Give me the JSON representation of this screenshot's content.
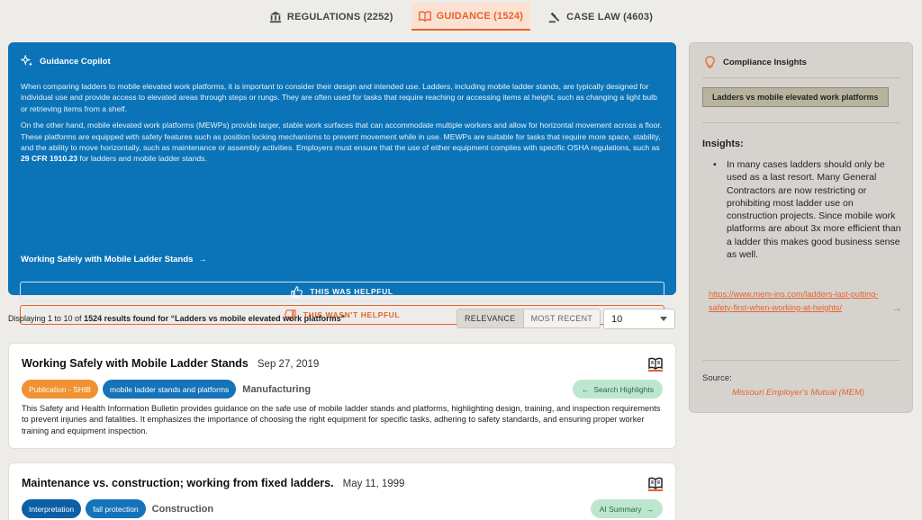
{
  "tabs": [
    {
      "label": "REGULATIONS (2252)",
      "icon": "bank-icon",
      "active": false
    },
    {
      "label": "GUIDANCE (1524)",
      "icon": "book-icon",
      "active": true
    },
    {
      "label": "CASE LAW (4603)",
      "icon": "gavel-icon",
      "active": false
    }
  ],
  "copilot": {
    "title": "Guidance Copilot",
    "para1": "When comparing ladders to mobile elevated work platforms, it is important to consider their design and intended use. Ladders, including mobile ladder stands, are typically designed for individual use and provide access to elevated areas through steps or rungs. They are often used for tasks that require reaching or accessing items at height, such as changing a light bulb or retrieving items from a shelf.",
    "para2_start": "On the other hand, mobile elevated work platforms (MEWPs) provide larger, stable work surfaces that can accommodate multiple workers and allow for horizontal movement across a floor. These platforms are equipped with safety features such as position locking mechanisms to prevent movement while in use. MEWPs are suitable for tasks that require more space, stability, and the ability to move horizontally, such as maintenance or assembly activities. Employers must ensure that the use of either equipment complies with specific OSHA regulations, such as ",
    "para2_bold": "29 CFR 1910.23",
    "para2_end": " for ladders and mobile ladder stands.",
    "link": "Working Safely with Mobile Ladder Stands",
    "helpful": "THIS WAS HELPFUL",
    "not_helpful": "THIS WASN'T HELPFUL"
  },
  "results": {
    "prefix": "Displaying 1 to 10 of ",
    "count": "1524",
    "suffix": " results found for “Ladders vs mobile elevated work platforms”",
    "sort_relevance": "RELEVANCE",
    "sort_recent": "MOST RECENT",
    "per_page": "10"
  },
  "cards": [
    {
      "title": "Working Safely with Mobile Ladder Stands",
      "date": "Sep 27, 2019",
      "tags": [
        "Publication - SHIB",
        "mobile ladder stands and platforms"
      ],
      "category": "Manufacturing",
      "action": "Search Highlights",
      "description": "This Safety and Health Information Bulletin provides guidance on the safe use of mobile ladder stands and platforms, highlighting design, training, and inspection requirements to prevent injuries and fatalities. It emphasizes the importance of choosing the right equipment for specific tasks, adhering to safety standards, and ensuring proper worker training and equipment inspection."
    },
    {
      "title": "Maintenance vs. construction; working from fixed ladders.",
      "date": "May 11, 1999",
      "tags": [
        "Interpretation",
        "fall protection"
      ],
      "category": "Construction",
      "action": "AI Summary"
    }
  ],
  "insights": {
    "title": "Compliance Insights",
    "query": "Ladders vs mobile elevated work platforms",
    "label": "Insights:",
    "bullet": "In many cases ladders should only be used as a last resort. Many General Contractors are now restricting or prohibiting most ladder use on construction projects. Since mobile work platforms are about 3x more efficient than a ladder this makes good business sense as well.",
    "link": "https://www.mem-ins.com/ladders-last-putting-safety-first-when-working-at-heights/",
    "source_label": "Source:",
    "source": "Missouri Employer's Mutual (MEM)"
  },
  "colors": {
    "accent": "#e8622b",
    "copilot_bg": "#0b74b8",
    "panel_bg": "#d6d3ce"
  }
}
